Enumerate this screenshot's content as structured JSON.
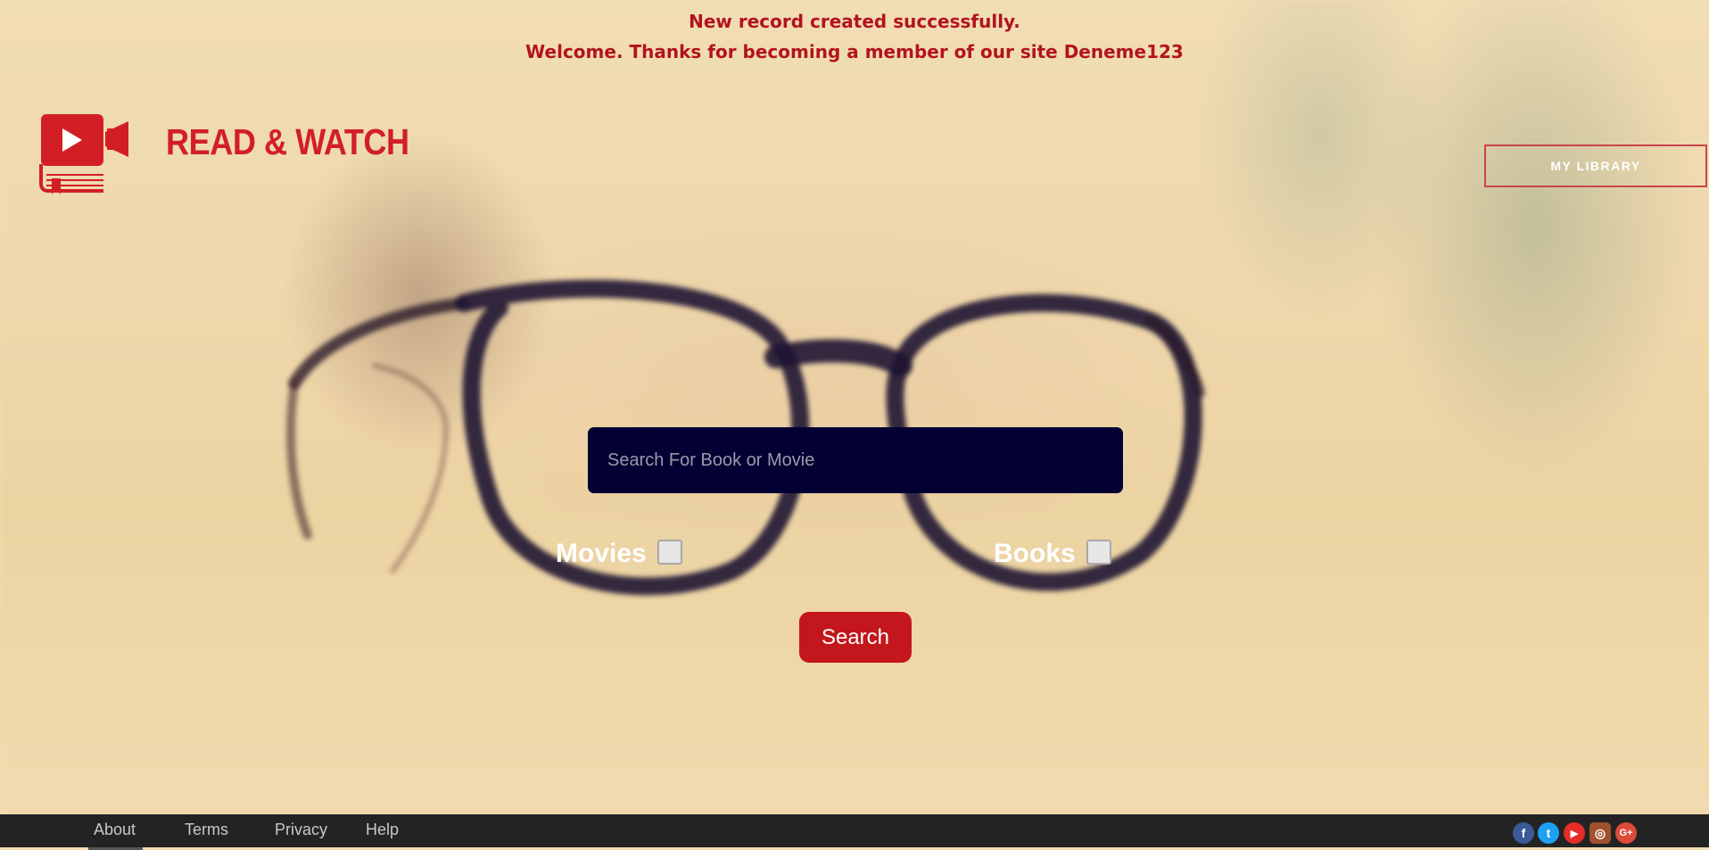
{
  "messages": {
    "line1": "New record created successfully.",
    "line2": "Welcome. Thanks for becoming a member of our site Deneme123"
  },
  "header": {
    "brand": "READ & WATCH",
    "library_button": "MY LIBRARY"
  },
  "search": {
    "placeholder": "Search For Book or Movie",
    "value": "",
    "movies_label": "Movies",
    "books_label": "Books",
    "movies_checked": false,
    "books_checked": false,
    "button": "Search"
  },
  "footer": {
    "links": [
      "About",
      "Terms",
      "Privacy",
      "Help"
    ],
    "social": [
      {
        "icon": "facebook-icon",
        "glyph": "f",
        "color": "#3b5998"
      },
      {
        "icon": "twitter-icon",
        "glyph": "t",
        "color": "#1da1f2"
      },
      {
        "icon": "youtube-icon",
        "glyph": "▶",
        "color": "#e52d27"
      },
      {
        "icon": "instagram-icon",
        "glyph": "◎",
        "color": "#a0522d"
      },
      {
        "icon": "google-plus-icon",
        "glyph": "G+",
        "color": "#dd4b39"
      }
    ]
  },
  "colors": {
    "accent": "#d21f26",
    "search_bg": "#030033",
    "footer_bg": "#232323"
  }
}
